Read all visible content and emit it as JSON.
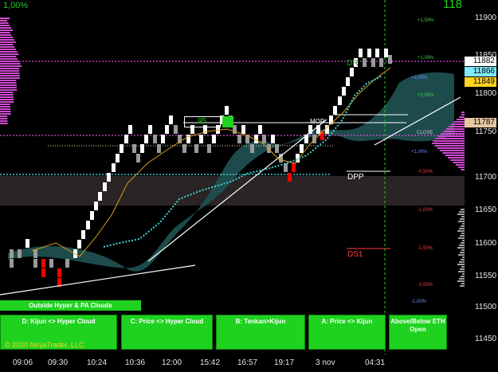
{
  "header": {
    "left_pct": "1,00%",
    "right_value": "118"
  },
  "price_axis": {
    "ticks": [
      "11900",
      "11850",
      "11800",
      "11750",
      "11700",
      "11650",
      "11600",
      "11550",
      "11500",
      "11450"
    ],
    "badges": [
      {
        "label": "11882",
        "bg": "#ffffff",
        "fg": "#000000"
      },
      {
        "label": "11866",
        "bg": "#7fe9ff",
        "fg": "#000000"
      },
      {
        "label": "11849",
        "bg": "#ffd21f",
        "fg": "#000000"
      },
      {
        "label": "11787",
        "bg": "#e6c8a0",
        "fg": "#000000"
      }
    ]
  },
  "time_axis": {
    "ticks": [
      "09:06",
      "09:30",
      "10:24",
      "10:36",
      "12:00",
      "15:42",
      "16:57",
      "19:17",
      "3 nov",
      "04:31"
    ]
  },
  "percent_labels": [
    {
      "text": "+1,50%",
      "color": "#3cd23c"
    },
    {
      "text": "+1,00%",
      "color": "#3cd23c"
    },
    {
      "text": "+2,00%",
      "color": "#6b8cff"
    },
    {
      "text": "+0,50%",
      "color": "#3cd23c"
    },
    {
      "text": "+1,00%",
      "color": "#6b8cff"
    },
    {
      "text": "-0,50%",
      "color": "#ff3b3b"
    },
    {
      "text": "-1,00%",
      "color": "#ff3b3b"
    },
    {
      "text": "-1,50%",
      "color": "#ff3b3b"
    },
    {
      "text": "-2,00%",
      "color": "#ff3b3b"
    },
    {
      "text": "-1,00%",
      "color": "#6b8cff"
    }
  ],
  "level_labels": {
    "dr": "DR",
    "mop": "MOP",
    "close": "CLOSE",
    "dpp": "DPP",
    "ds1": "DS1"
  },
  "counter_box": {
    "value": "95"
  },
  "indicator_panels": {
    "outside": "Outside Hyper & PA Clouds",
    "buttons": [
      "D: Kijun <> Hyper Cloud",
      "C: Price <> Hyper Cloud",
      "B: Tenkan>Kijun",
      "A: Price <> Kijun",
      "Above/Below ETH Open"
    ]
  },
  "copyright": "© 2020 NinjaTrader, LLC",
  "colors": {
    "background": "#000000",
    "cloud": "#1f4f4f",
    "band": "#2a2424",
    "magenta": "#d24bd2",
    "cyan_dots": "#3fd4d4",
    "accent_green": "#1fd21f",
    "brick_up": "#ffffff",
    "brick_down": "#ff0000",
    "brick_neutral": "#9a9a9a"
  }
}
